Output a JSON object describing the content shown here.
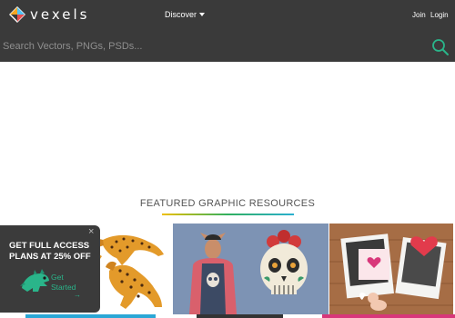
{
  "header": {
    "logo_text": "vexels",
    "nav_discover": "Discover",
    "join": "Join",
    "login": "Login"
  },
  "search": {
    "placeholder": "Search Vectors, PNGs, PSDs..."
  },
  "featured": {
    "title": "FEATURED GRAPHIC RESOURCES"
  },
  "promo": {
    "headline": "GET FULL ACCESS PLANS AT 25% OFF",
    "cta": "Get Started",
    "arrow": "→",
    "close": "×"
  },
  "cards": [
    {
      "name": "leopard-illustration"
    },
    {
      "name": "skull-tshirt-mockup"
    },
    {
      "name": "valentines-day-polaroid"
    }
  ],
  "colors": {
    "header_bg": "#3a3a3a",
    "accent_teal": "#2ab58a",
    "strip_blue": "#2aa7d6",
    "strip_dark": "#333333",
    "strip_pink": "#d8377a"
  }
}
